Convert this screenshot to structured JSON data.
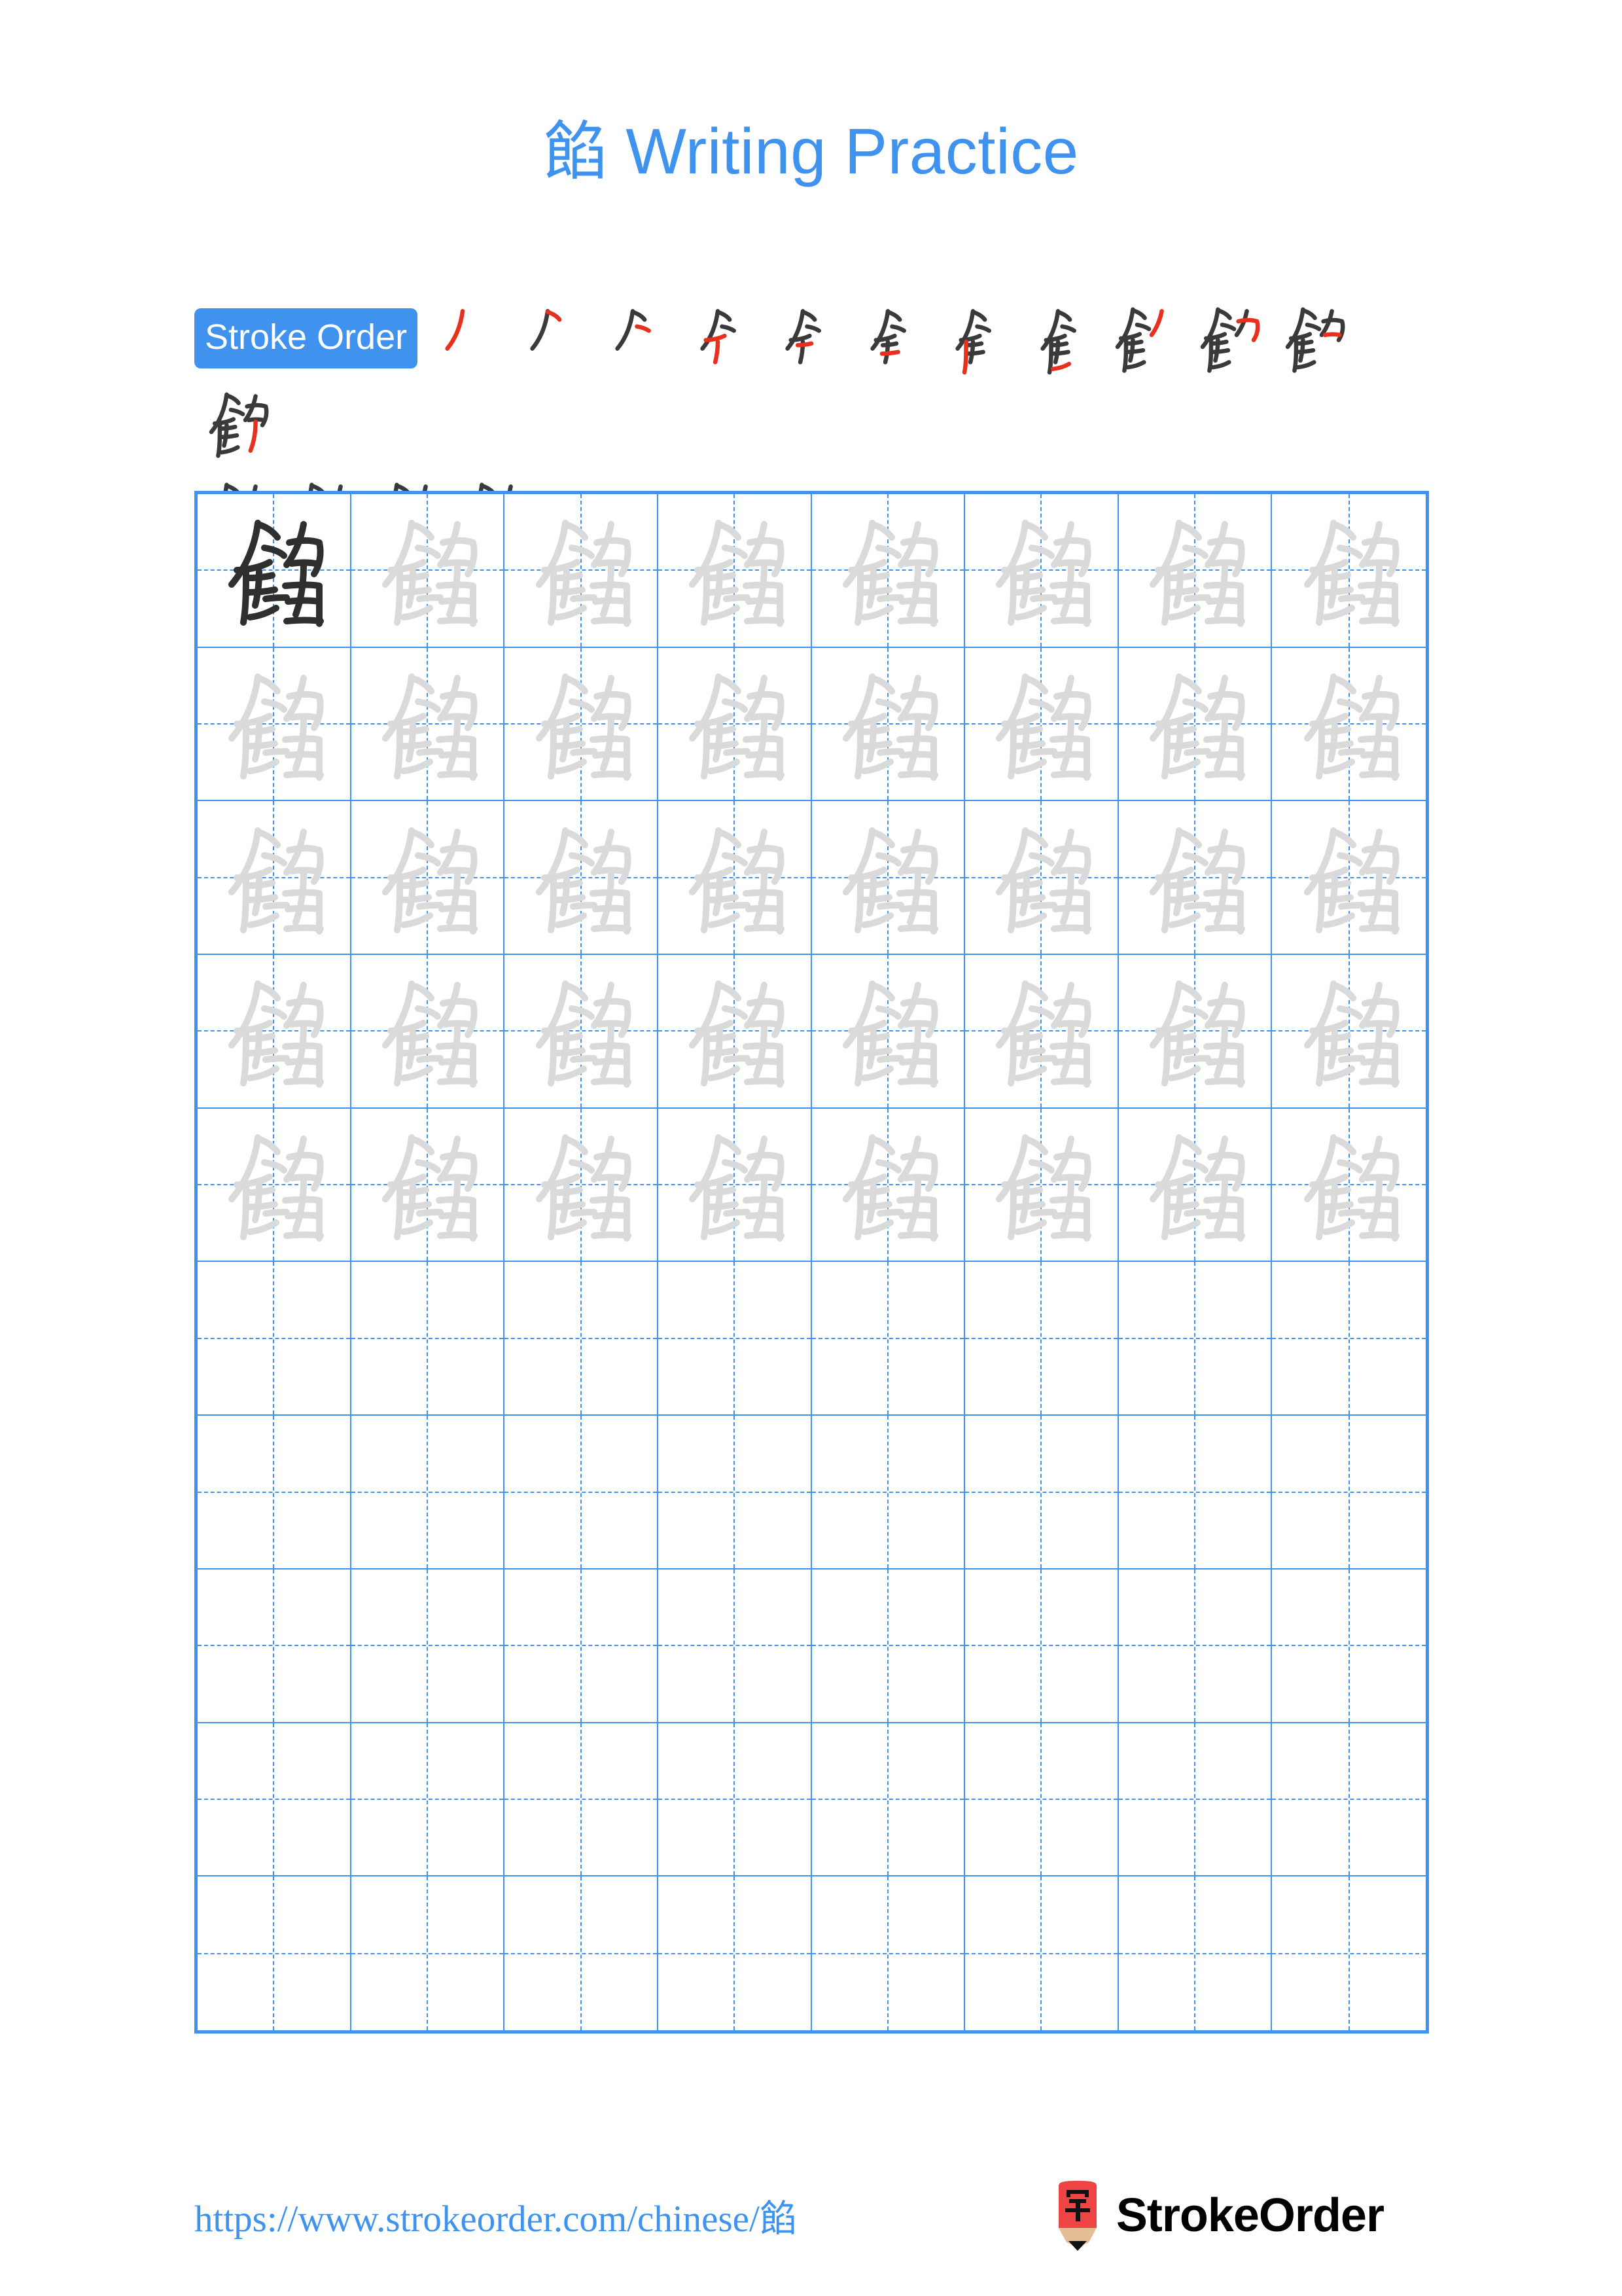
{
  "page": {
    "background_color": "#ffffff",
    "accent_color": "#3f93ee",
    "stroke_ink_color": "#3a3a3a",
    "new_stroke_color": "#e8301f",
    "trace_gray_color": "#dadada"
  },
  "header": {
    "character": "餡",
    "title_suffix": " Writing Practice",
    "title_full": "餡 Writing Practice"
  },
  "stroke_order": {
    "badge_label": "Stroke Order",
    "total_strokes": 16,
    "row1_count": 12,
    "row2_count": 4,
    "steps": [
      {
        "index": 1,
        "glyph": "丿"
      },
      {
        "index": 2,
        "glyph": "𠂉"
      },
      {
        "index": 3,
        "glyph": "𠂎"
      },
      {
        "index": 4,
        "glyph": "亽"
      },
      {
        "index": 5,
        "glyph": "今"
      },
      {
        "index": 6,
        "glyph": "仺"
      },
      {
        "index": 7,
        "glyph": "𠆢"
      },
      {
        "index": 8,
        "glyph": "𩙿"
      },
      {
        "index": 9,
        "glyph": "食"
      },
      {
        "index": 10,
        "glyph": "飠"
      },
      {
        "index": 11,
        "glyph": "飣"
      },
      {
        "index": 12,
        "glyph": "飦"
      },
      {
        "index": 13,
        "glyph": "飥"
      },
      {
        "index": 14,
        "glyph": "飪"
      },
      {
        "index": 15,
        "glyph": "飬"
      },
      {
        "index": 16,
        "glyph": "餡"
      }
    ]
  },
  "practice_grid": {
    "columns": 8,
    "rows": 10,
    "filled_rows": 5,
    "empty_rows": 5,
    "character": "餡",
    "first_cell_style": "solid-dark",
    "trace_cell_style": "light-gray",
    "guide_lines": "dashed-cross"
  },
  "footer": {
    "url": "https://www.strokeorder.com/chinese/餡",
    "brand_name": "StrokeOrder",
    "logo_character": "字",
    "logo_body_color": "#ef4444",
    "logo_wood_color": "#e4bd94",
    "logo_tip_color": "#111111"
  }
}
